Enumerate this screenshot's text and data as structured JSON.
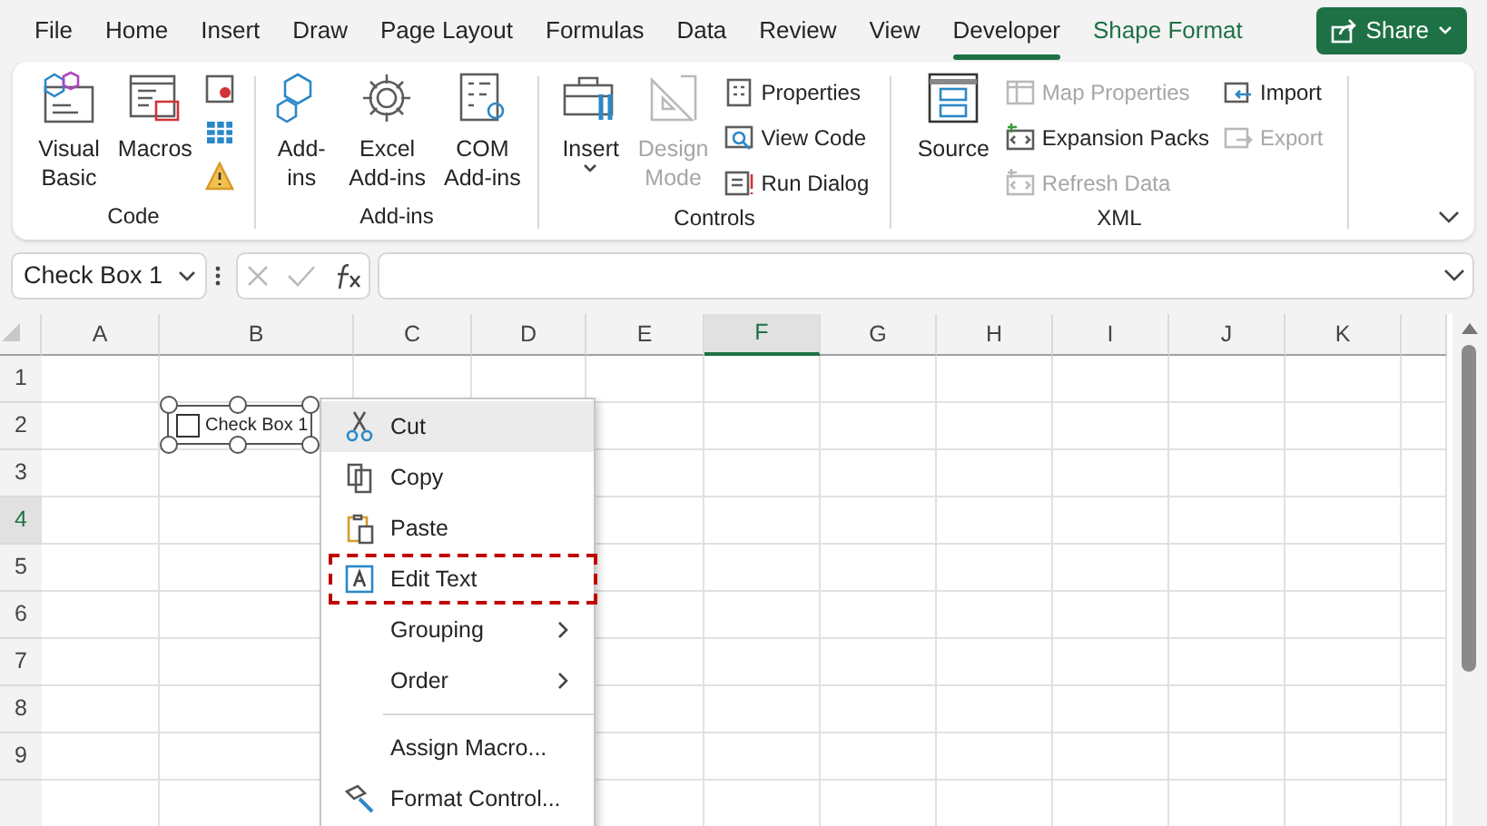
{
  "menu_tabs": [
    {
      "label": "File",
      "kind": "tab",
      "selected": false
    },
    {
      "label": "Home",
      "kind": "tab",
      "selected": false
    },
    {
      "label": "Insert",
      "kind": "tab",
      "selected": false
    },
    {
      "label": "Draw",
      "kind": "tab",
      "selected": false
    },
    {
      "label": "Page Layout",
      "kind": "tab",
      "selected": false
    },
    {
      "label": "Formulas",
      "kind": "tab",
      "selected": false
    },
    {
      "label": "Data",
      "kind": "tab",
      "selected": false
    },
    {
      "label": "Review",
      "kind": "tab",
      "selected": false
    },
    {
      "label": "View",
      "kind": "tab",
      "selected": false
    },
    {
      "label": "Developer",
      "kind": "tab",
      "selected": true
    },
    {
      "label": "Shape Format",
      "kind": "contextual",
      "selected": false
    }
  ],
  "share_button": {
    "label": "Share"
  },
  "ribbon": {
    "groups": [
      {
        "label": "Code",
        "items": [
          {
            "kind": "large",
            "lines": [
              "Visual",
              "Basic"
            ],
            "disabled": false
          },
          {
            "kind": "large",
            "lines": [
              "Macros"
            ],
            "disabled": false
          },
          {
            "kind": "icons",
            "icons": [
              {
                "kind": "record"
              },
              {
                "kind": "grid"
              },
              {
                "kind": "warning"
              }
            ]
          }
        ]
      },
      {
        "label": "Add-ins",
        "items": [
          {
            "kind": "large",
            "lines": [
              "Add-",
              "ins"
            ],
            "disabled": false
          },
          {
            "kind": "large",
            "lines": [
              "Excel",
              "Add-ins"
            ],
            "disabled": false
          },
          {
            "kind": "large",
            "lines": [
              "COM",
              "Add-ins"
            ],
            "disabled": false
          }
        ]
      },
      {
        "label": "Controls",
        "items": [
          {
            "kind": "dropdown",
            "lines": [
              "Insert"
            ],
            "disabled": false
          },
          {
            "kind": "large",
            "lines": [
              "Design",
              "Mode"
            ],
            "disabled": true
          },
          {
            "kind": "small",
            "labels": [
              "Properties",
              "View Code",
              "Run Dialog"
            ],
            "disabled": false
          }
        ]
      },
      {
        "label": "XML",
        "items": [
          {
            "kind": "large",
            "lines": [
              "Source"
            ],
            "disabled": false
          },
          {
            "kind": "smallset",
            "entries": [
              {
                "label": "Map Properties",
                "disabled": true
              },
              {
                "label": "Expansion Packs",
                "disabled": false
              },
              {
                "label": "Refresh Data",
                "disabled": true
              }
            ]
          },
          {
            "kind": "smallset",
            "entries": [
              {
                "label": "Import",
                "disabled": false
              },
              {
                "label": "Export",
                "disabled": true
              }
            ]
          }
        ]
      }
    ]
  },
  "name_box": {
    "value": "Check Box 1"
  },
  "columns": [
    {
      "label": "A",
      "selected": false
    },
    {
      "label": "B",
      "selected": false
    },
    {
      "label": "C",
      "selected": false
    },
    {
      "label": "D",
      "selected": false
    },
    {
      "label": "E",
      "selected": false
    },
    {
      "label": "F",
      "selected": true
    },
    {
      "label": "G",
      "selected": false
    },
    {
      "label": "H",
      "selected": false
    },
    {
      "label": "I",
      "selected": false
    },
    {
      "label": "J",
      "selected": false
    },
    {
      "label": "K",
      "selected": false
    }
  ],
  "rows": [
    {
      "label": "1",
      "selected": false
    },
    {
      "label": "2",
      "selected": false
    },
    {
      "label": "3",
      "selected": false
    },
    {
      "label": "4",
      "selected": true
    },
    {
      "label": "5",
      "selected": false
    },
    {
      "label": "6",
      "selected": false
    },
    {
      "label": "7",
      "selected": false
    },
    {
      "label": "8",
      "selected": false
    },
    {
      "label": "9",
      "selected": false
    }
  ],
  "checkbox_control": {
    "label": "Check Box 1",
    "checked": false
  },
  "context_menu": [
    {
      "kind": "item",
      "label": "Cut",
      "hovered": true,
      "highlighted": false
    },
    {
      "kind": "item",
      "label": "Copy",
      "hovered": false,
      "highlighted": false
    },
    {
      "kind": "item",
      "label": "Paste",
      "hovered": false,
      "highlighted": false
    },
    {
      "kind": "item",
      "label": "Edit Text",
      "hovered": false,
      "highlighted": true
    },
    {
      "kind": "submenu",
      "label": "Grouping",
      "hovered": false,
      "highlighted": false
    },
    {
      "kind": "submenu",
      "label": "Order",
      "hovered": false,
      "highlighted": false
    },
    {
      "kind": "separator"
    },
    {
      "kind": "item",
      "label": "Assign Macro...",
      "hovered": false,
      "highlighted": false
    },
    {
      "kind": "item",
      "label": "Format Control...",
      "hovered": false,
      "highlighted": false
    }
  ]
}
